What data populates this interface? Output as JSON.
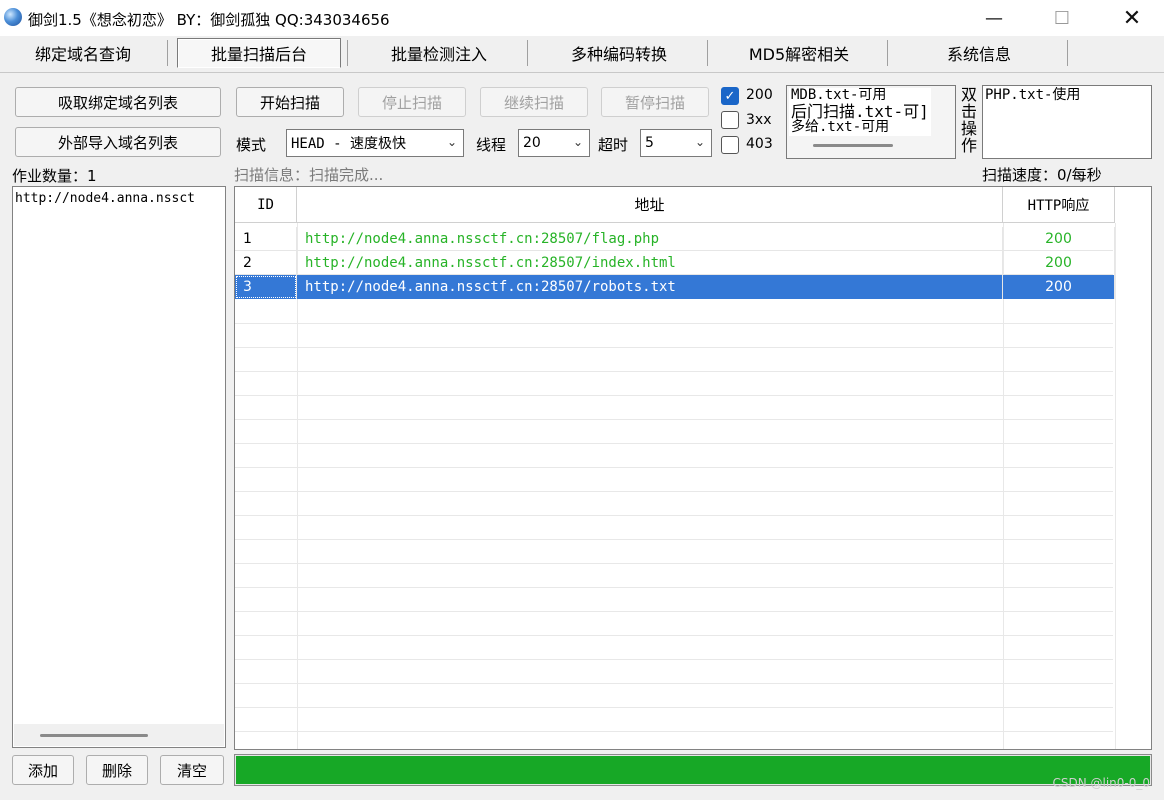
{
  "window": {
    "title": "御剑1.5《想念初恋》 BY：御剑孤独 QQ:343034656",
    "minimize": "—",
    "maximize": "☐",
    "close": "✕"
  },
  "tabs": [
    {
      "label": "绑定域名查询"
    },
    {
      "label": "批量扫描后台",
      "active": true
    },
    {
      "label": "批量检测注入"
    },
    {
      "label": "多种编码转换"
    },
    {
      "label": "MD5解密相关"
    },
    {
      "label": "系统信息"
    }
  ],
  "controls": {
    "fetch_bound_domains": "吸取绑定域名列表",
    "import_domains": "外部导入域名列表",
    "start_scan": "开始扫描",
    "stop_scan": "停止扫描",
    "resume_scan": "继续扫描",
    "pause_scan": "暂停扫描",
    "mode_label": "模式",
    "mode_value": "HEAD - 速度极快",
    "threads_label": "线程",
    "threads_value": "20",
    "timeout_label": "超时",
    "timeout_value": "5",
    "status_200": "200",
    "status_3xx": "3xx",
    "status_403": "403",
    "job_count": "作业数量：1",
    "scan_info": "扫描信息：扫描完成...",
    "scan_speed": "扫描速度：0/每秒",
    "dbl_click_hint": [
      "双",
      "击",
      "操",
      "作"
    ]
  },
  "dictionaries": [
    "MDB.txt-可用",
    "后门扫描.txt-可]",
    "多给.txt-可用"
  ],
  "php_dict": "PHP.txt-使用",
  "domain_list": [
    "http://node4.anna.nssct"
  ],
  "table": {
    "headers": {
      "id": "ID",
      "url": "地址",
      "http": "HTTP响应"
    },
    "rows": [
      {
        "id": "1",
        "url": "http://node4.anna.nssctf.cn:28507/flag.php",
        "code": "200"
      },
      {
        "id": "2",
        "url": "http://node4.anna.nssctf.cn:28507/index.html",
        "code": "200"
      },
      {
        "id": "3",
        "url": "http://node4.anna.nssctf.cn:28507/robots.txt",
        "code": "200",
        "selected": true
      }
    ]
  },
  "list_actions": {
    "add": "添加",
    "delete": "删除",
    "clear": "清空"
  },
  "progress": {
    "percent": 100,
    "color": "#17a826"
  },
  "watermark": "CSDN @lin0-0_0"
}
